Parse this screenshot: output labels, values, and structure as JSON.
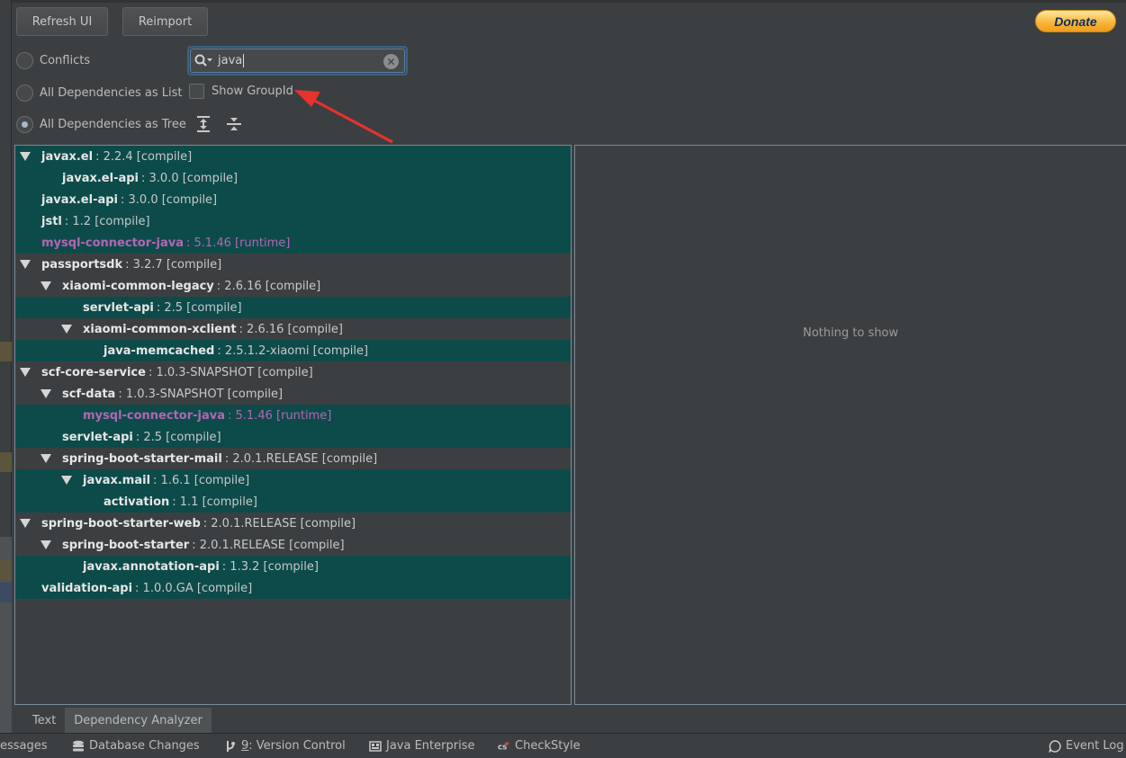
{
  "toolbar": {
    "refresh_label": "Refresh UI",
    "reimport_label": "Reimport",
    "donate_label": "Donate"
  },
  "modes": {
    "conflicts": "Conflicts",
    "list": "All Dependencies as List",
    "tree": "All Dependencies as Tree",
    "selected": "tree"
  },
  "search": {
    "value": "java"
  },
  "show_groupid": {
    "label": "Show GroupId",
    "checked": false
  },
  "tree": [
    {
      "name": "javax.el",
      "info": ": 2.2.4 [compile]",
      "level": 0,
      "expanded": true,
      "highlight": true,
      "scope": "compile"
    },
    {
      "name": "javax.el-api",
      "info": ": 3.0.0 [compile]",
      "level": 1,
      "expanded": false,
      "highlight": true,
      "scope": "compile"
    },
    {
      "name": "javax.el-api",
      "info": ": 3.0.0 [compile]",
      "level": 0,
      "expanded": false,
      "highlight": true,
      "scope": "compile"
    },
    {
      "name": "jstl",
      "info": ": 1.2 [compile]",
      "level": 0,
      "expanded": false,
      "highlight": true,
      "scope": "compile"
    },
    {
      "name": "mysql-connector-java",
      "info": ": 5.1.46 [runtime]",
      "level": 0,
      "expanded": false,
      "highlight": true,
      "scope": "runtime"
    },
    {
      "name": "passportsdk",
      "info": ": 3.2.7 [compile]",
      "level": 0,
      "expanded": true,
      "highlight": false,
      "scope": "compile"
    },
    {
      "name": "xiaomi-common-legacy",
      "info": ": 2.6.16 [compile]",
      "level": 1,
      "expanded": true,
      "highlight": false,
      "scope": "compile"
    },
    {
      "name": "servlet-api",
      "info": ": 2.5 [compile]",
      "level": 2,
      "expanded": false,
      "highlight": true,
      "scope": "compile"
    },
    {
      "name": "xiaomi-common-xclient",
      "info": ": 2.6.16 [compile]",
      "level": 2,
      "expanded": true,
      "highlight": false,
      "scope": "compile"
    },
    {
      "name": "java-memcached",
      "info": ": 2.5.1.2-xiaomi [compile]",
      "level": 3,
      "expanded": false,
      "highlight": true,
      "scope": "compile"
    },
    {
      "name": "scf-core-service",
      "info": ": 1.0.3-SNAPSHOT [compile]",
      "level": 0,
      "expanded": true,
      "highlight": false,
      "scope": "compile"
    },
    {
      "name": "scf-data",
      "info": ": 1.0.3-SNAPSHOT [compile]",
      "level": 1,
      "expanded": true,
      "highlight": false,
      "scope": "compile"
    },
    {
      "name": "mysql-connector-java",
      "info": ": 5.1.46 [runtime]",
      "level": 2,
      "expanded": false,
      "highlight": true,
      "scope": "runtime"
    },
    {
      "name": "servlet-api",
      "info": ": 2.5 [compile]",
      "level": 1,
      "expanded": false,
      "highlight": true,
      "scope": "compile"
    },
    {
      "name": "spring-boot-starter-mail",
      "info": ": 2.0.1.RELEASE [compile]",
      "level": 1,
      "expanded": true,
      "highlight": false,
      "scope": "compile"
    },
    {
      "name": "javax.mail",
      "info": ": 1.6.1 [compile]",
      "level": 2,
      "expanded": true,
      "highlight": true,
      "scope": "compile"
    },
    {
      "name": "activation",
      "info": ": 1.1 [compile]",
      "level": 3,
      "expanded": false,
      "highlight": true,
      "scope": "compile"
    },
    {
      "name": "spring-boot-starter-web",
      "info": ": 2.0.1.RELEASE [compile]",
      "level": 0,
      "expanded": true,
      "highlight": false,
      "scope": "compile"
    },
    {
      "name": "spring-boot-starter",
      "info": ": 2.0.1.RELEASE [compile]",
      "level": 1,
      "expanded": true,
      "highlight": false,
      "scope": "compile"
    },
    {
      "name": "javax.annotation-api",
      "info": ": 1.3.2 [compile]",
      "level": 2,
      "expanded": false,
      "highlight": true,
      "scope": "compile"
    },
    {
      "name": "validation-api",
      "info": ": 1.0.0.GA [compile]",
      "level": 0,
      "expanded": false,
      "highlight": true,
      "scope": "compile"
    }
  ],
  "detail": {
    "empty_text": "Nothing to show"
  },
  "bottom_tabs": [
    {
      "label": "Text",
      "active": false
    },
    {
      "label": "Dependency Analyzer",
      "active": true
    }
  ],
  "statusbar": {
    "messages": "essages",
    "db_changes": "Database Changes",
    "vc_number": "9",
    "vc_label": ": Version Control",
    "java_enterprise": "Java Enterprise",
    "checkstyle": "CheckStyle",
    "event_log": "Event Log"
  },
  "colors": {
    "highlight_row": "#0d4b4a",
    "runtime": "#b565b3",
    "annotation_arrow": "#e8322c"
  },
  "icons": {
    "expand_all": "expand-all-icon",
    "collapse_all": "collapse-all-icon",
    "search": "search-icon",
    "clear": "clear-icon"
  }
}
